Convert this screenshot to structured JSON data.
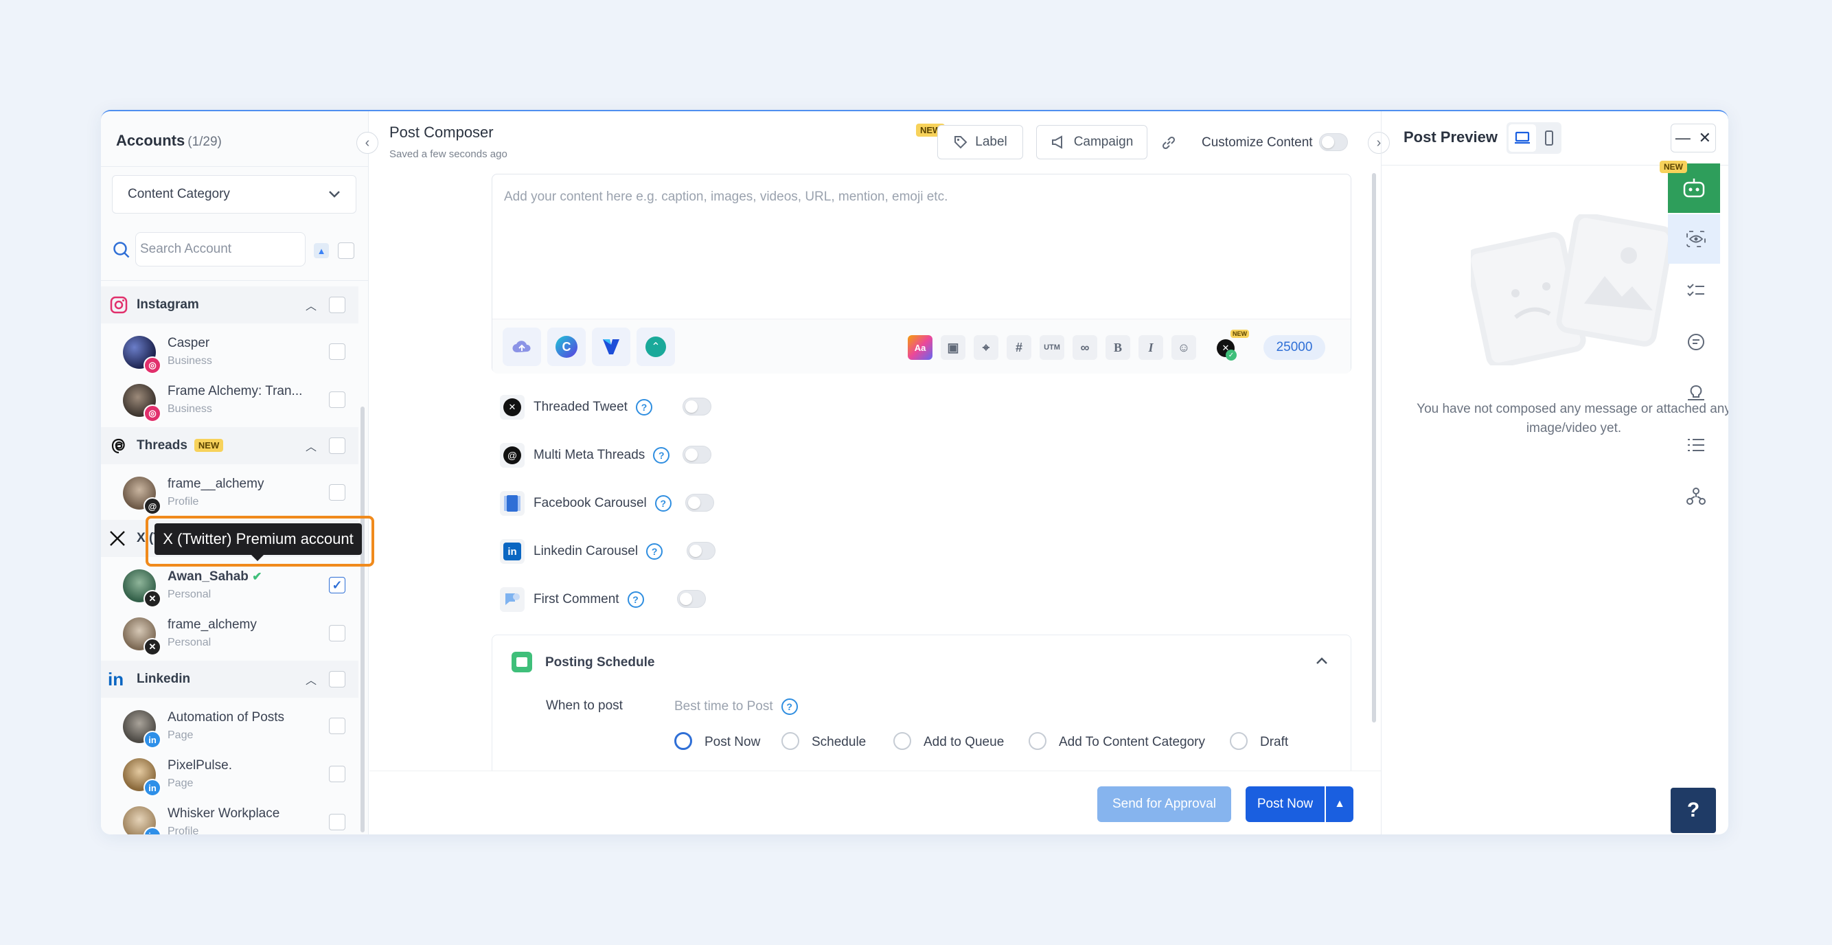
{
  "accounts": {
    "title": "Accounts",
    "count": "(1/29)",
    "category_placeholder": "Content Category",
    "search_placeholder": "Search Account",
    "groups": [
      {
        "label": "Instagram",
        "items": [
          {
            "name": "Casper",
            "type": "Business"
          },
          {
            "name": "Frame Alchemy: Tran...",
            "type": "Business"
          }
        ]
      },
      {
        "label": "Threads",
        "badge": "NEW",
        "items": [
          {
            "name": "frame__alchemy",
            "type": "Profile"
          }
        ]
      },
      {
        "label": "X (Twitter)",
        "items": [
          {
            "name": "Awan_Sahab",
            "type": "Personal",
            "checked": true
          },
          {
            "name": "frame_alchemy",
            "type": "Personal"
          }
        ]
      },
      {
        "label": "Linkedin",
        "items": [
          {
            "name": "Automation of Posts",
            "type": "Page"
          },
          {
            "name": "PixelPulse.",
            "type": "Page"
          },
          {
            "name": "Whisker Workplace",
            "type": "Profile"
          }
        ]
      }
    ],
    "tooltip": "X (Twitter) Premium account"
  },
  "composer": {
    "title": "Post Composer",
    "saved": "Saved a few seconds ago",
    "new_badge": "NEW",
    "label_btn": "Label",
    "campaign_btn": "Campaign",
    "customize": "Customize Content",
    "placeholder": "Add your content here e.g. caption, images, videos, URL, mention, emoji etc.",
    "char_count": "25000",
    "options": [
      {
        "label": "Threaded Tweet"
      },
      {
        "label": "Multi Meta Threads"
      },
      {
        "label": "Facebook Carousel"
      },
      {
        "label": "Linkedin Carousel"
      },
      {
        "label": "First Comment"
      }
    ],
    "schedule": {
      "title": "Posting Schedule",
      "when_label": "When to post",
      "best_time": "Best time to Post",
      "choices": [
        "Post Now",
        "Schedule",
        "Add to Queue",
        "Add To Content Category",
        "Draft"
      ],
      "selected": "Post Now"
    },
    "send_approval": "Send for Approval",
    "post_now": "Post Now"
  },
  "preview": {
    "title": "Post Preview",
    "empty_msg": "You have not composed any message or attached any image/video yet.",
    "new_badge": "NEW",
    "help": "?"
  },
  "colors": {
    "accent": "#1a5fe0",
    "tooltip_highlight": "#f08a1c",
    "instagram": "#e1306c",
    "linkedin": "#0a66c2",
    "ai_green": "#2e9e5b"
  }
}
